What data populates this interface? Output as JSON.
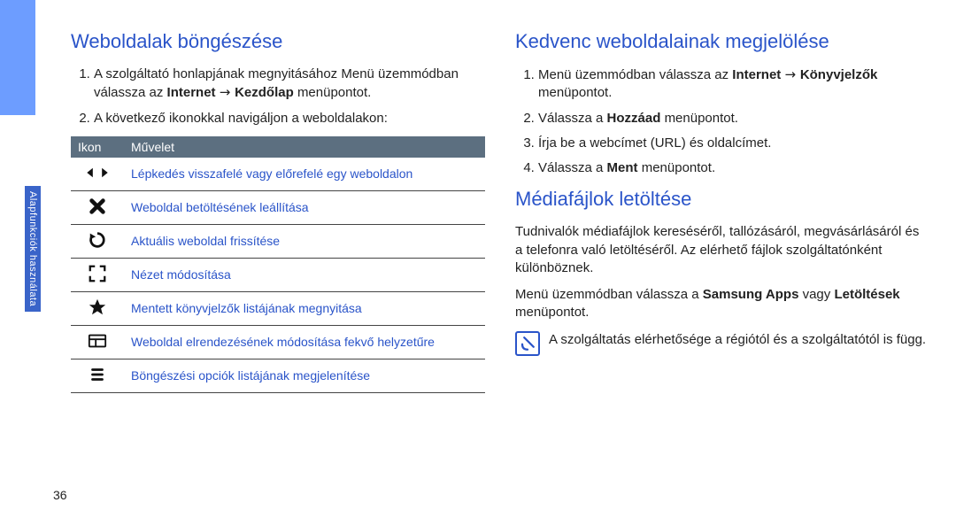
{
  "page_number": "36",
  "side_tab": "Alapfunkciók használata",
  "left": {
    "heading": "Weboldalak böngészése",
    "step1_pre": "A szolgáltató honlapjának megnyitásához Menü üzemmódban válassza az ",
    "step1_kw1": "Internet",
    "step1_arrow": " → ",
    "step1_kw2": "Kezdőlap",
    "step1_post": " menüpontot.",
    "step2": "A következő ikonokkal navigáljon a weboldalakon:",
    "table": {
      "head_icon": "Ikon",
      "head_op": "Művelet",
      "rows": [
        {
          "icon": "navarrows",
          "text": "Lépkedés visszafelé vagy előrefelé egy weboldalon"
        },
        {
          "icon": "stop",
          "text": "Weboldal betöltésének leállítása"
        },
        {
          "icon": "refresh",
          "text": "Aktuális weboldal frissítése"
        },
        {
          "icon": "expand",
          "text": "Nézet módosítása"
        },
        {
          "icon": "star",
          "text": "Mentett könyvjelzők listájának megnyitása"
        },
        {
          "icon": "layout",
          "text": "Weboldal elrendezésének módosítása fekvő helyzetűre"
        },
        {
          "icon": "list",
          "text": "Böngészési opciók listájának megjelenítése"
        }
      ]
    }
  },
  "right": {
    "heading1": "Kedvenc weboldalainak megjelölése",
    "s1_pre": "Menü üzemmódban válassza az ",
    "s1_kw1": "Internet",
    "s1_arrow": " → ",
    "s1_kw2": "Könyvjelzők",
    "s1_post": " menüpontot.",
    "s2_pre": "Válassza a ",
    "s2_kw": "Hozzáad",
    "s2_post": " menüpontot.",
    "s3": "Írja be a webcímet (URL) és oldalcímet.",
    "s4_pre": "Válassza a ",
    "s4_kw": "Ment",
    "s4_post": " menüpontot.",
    "heading2": "Médiafájlok letöltése",
    "p1": "Tudnivalók médiafájlok kereséséről, tallózásáról, megvásárlásáról és a telefonra való letöltéséről. Az elérhető fájlok szolgáltatónként különböznek.",
    "p2_pre": "Menü üzemmódban válassza a ",
    "p2_kw1": "Samsung Apps",
    "p2_mid": " vagy ",
    "p2_kw2": "Letöltések",
    "p2_post": " menüpontot.",
    "note": "A szolgáltatás elérhetősége a régiótól és a szolgáltatótól is függ."
  }
}
